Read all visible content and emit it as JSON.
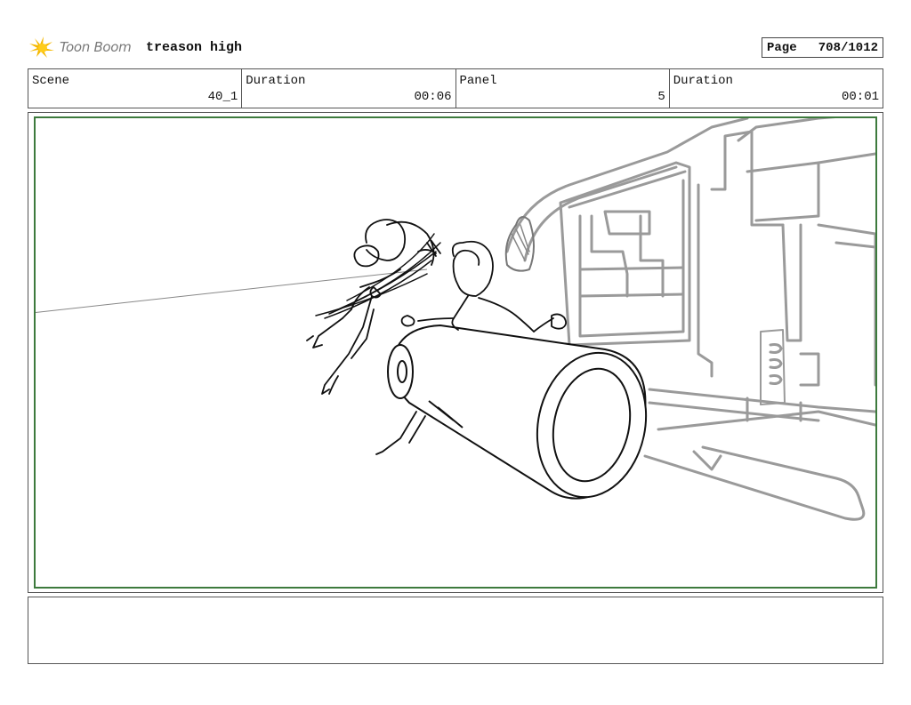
{
  "header": {
    "logo_text": "Toon Boom",
    "project_title": "treason high",
    "page_label": "Page",
    "page_value": "708/1012"
  },
  "info": {
    "scene_label": "Scene",
    "scene_value": "40_1",
    "scene_duration_label": "Duration",
    "scene_duration_value": "00:06",
    "panel_label": "Panel",
    "panel_value": "5",
    "panel_duration_label": "Duration",
    "panel_duration_value": "00:01"
  },
  "notes": {
    "text": ""
  },
  "colors": {
    "panel_border": "#3d7a3d",
    "logo_yellow": "#f5b800",
    "sketch_gray": "#9a9a9a",
    "sketch_black": "#111111"
  },
  "icons": {
    "logo": "toon-boom-star-logo-icon"
  }
}
